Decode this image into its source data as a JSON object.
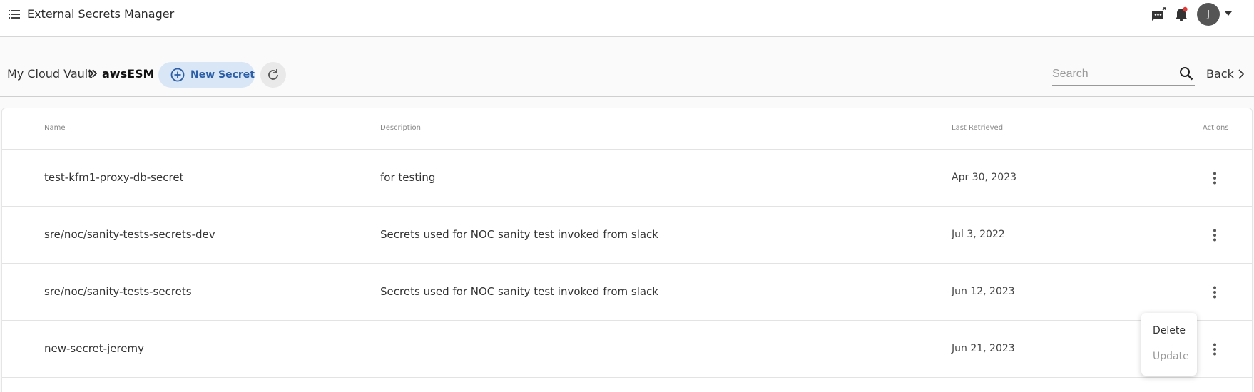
{
  "header": {
    "app_title": "External Secrets Manager",
    "user_initial": "J",
    "icons": [
      "menu-list-icon",
      "chat-notification-icon",
      "bell-icon",
      "avatar",
      "caret-down-icon"
    ],
    "colors": {
      "notification_dot": "#e53935"
    }
  },
  "toolbar": {
    "breadcrumb_root": "My Cloud Vault",
    "breadcrumb_current": "awsESM",
    "new_secret_label": "New Secret",
    "search_placeholder": "Search",
    "back_label": "Back",
    "colors": {
      "new_secret_bg": "#d9e6f6",
      "new_secret_fg": "#2b5ea7"
    }
  },
  "table": {
    "columns": {
      "name": "Name",
      "description": "Description",
      "last_retrieved": "Last Retrieved",
      "actions": "Actions"
    },
    "rows": [
      {
        "name": "test-kfm1-proxy-db-secret",
        "description": "for testing",
        "last_retrieved": "Apr 30, 2023"
      },
      {
        "name": "sre/noc/sanity-tests-secrets-dev",
        "description": "Secrets used for NOC sanity test invoked from slack",
        "last_retrieved": "Jul 3, 2022"
      },
      {
        "name": "sre/noc/sanity-tests-secrets",
        "description": "Secrets used for NOC sanity test invoked from slack",
        "last_retrieved": "Jun 12, 2023"
      },
      {
        "name": "new-secret-jeremy",
        "description": "",
        "last_retrieved": "Jun 21, 2023"
      }
    ]
  },
  "actions_menu": {
    "delete_label": "Delete",
    "update_label": "Update"
  }
}
